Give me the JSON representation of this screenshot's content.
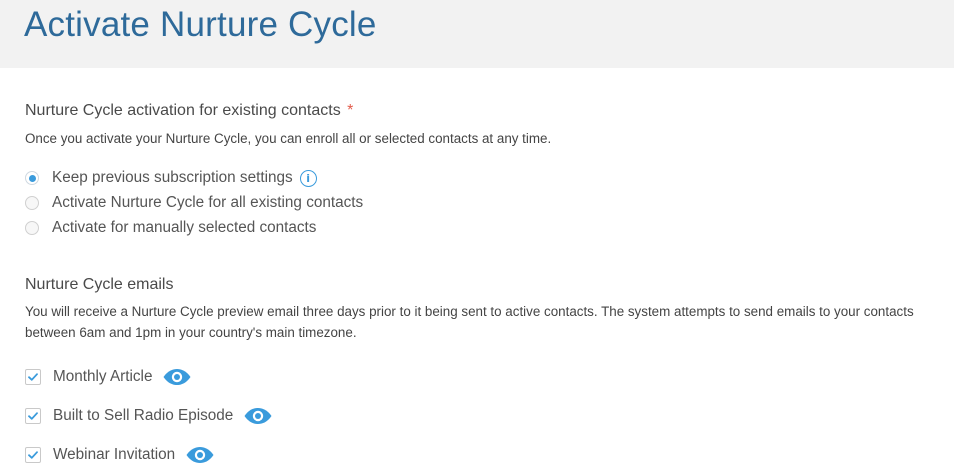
{
  "header": {
    "title": "Activate Nurture Cycle"
  },
  "activation": {
    "title": "Nurture Cycle activation for existing contacts",
    "required_mark": "*",
    "description": "Once you activate your Nurture Cycle, you can enroll all or selected contacts at any time.",
    "options": [
      {
        "label": "Keep previous subscription settings",
        "selected": true,
        "info_icon": "info-icon"
      },
      {
        "label": "Activate Nurture Cycle for all existing contacts",
        "selected": false
      },
      {
        "label": "Activate for manually selected contacts",
        "selected": false
      }
    ]
  },
  "emails": {
    "title": "Nurture Cycle emails",
    "description": "You will receive a Nurture Cycle preview email three days prior to it being sent to active contacts. The system attempts to send emails to your contacts between 6am and 1pm in your country's main timezone.",
    "items": [
      {
        "label": "Monthly Article",
        "checked": true,
        "preview_icon": "eye-icon"
      },
      {
        "label": "Built to Sell Radio Episode",
        "checked": true,
        "preview_icon": "eye-icon"
      },
      {
        "label": "Webinar Invitation",
        "checked": true,
        "preview_icon": "eye-icon"
      }
    ]
  },
  "colors": {
    "title_blue": "#2e6a9a",
    "accent_blue": "#3a9bdc",
    "required_red": "#e25a4a",
    "header_bg": "#f2f2f2"
  }
}
